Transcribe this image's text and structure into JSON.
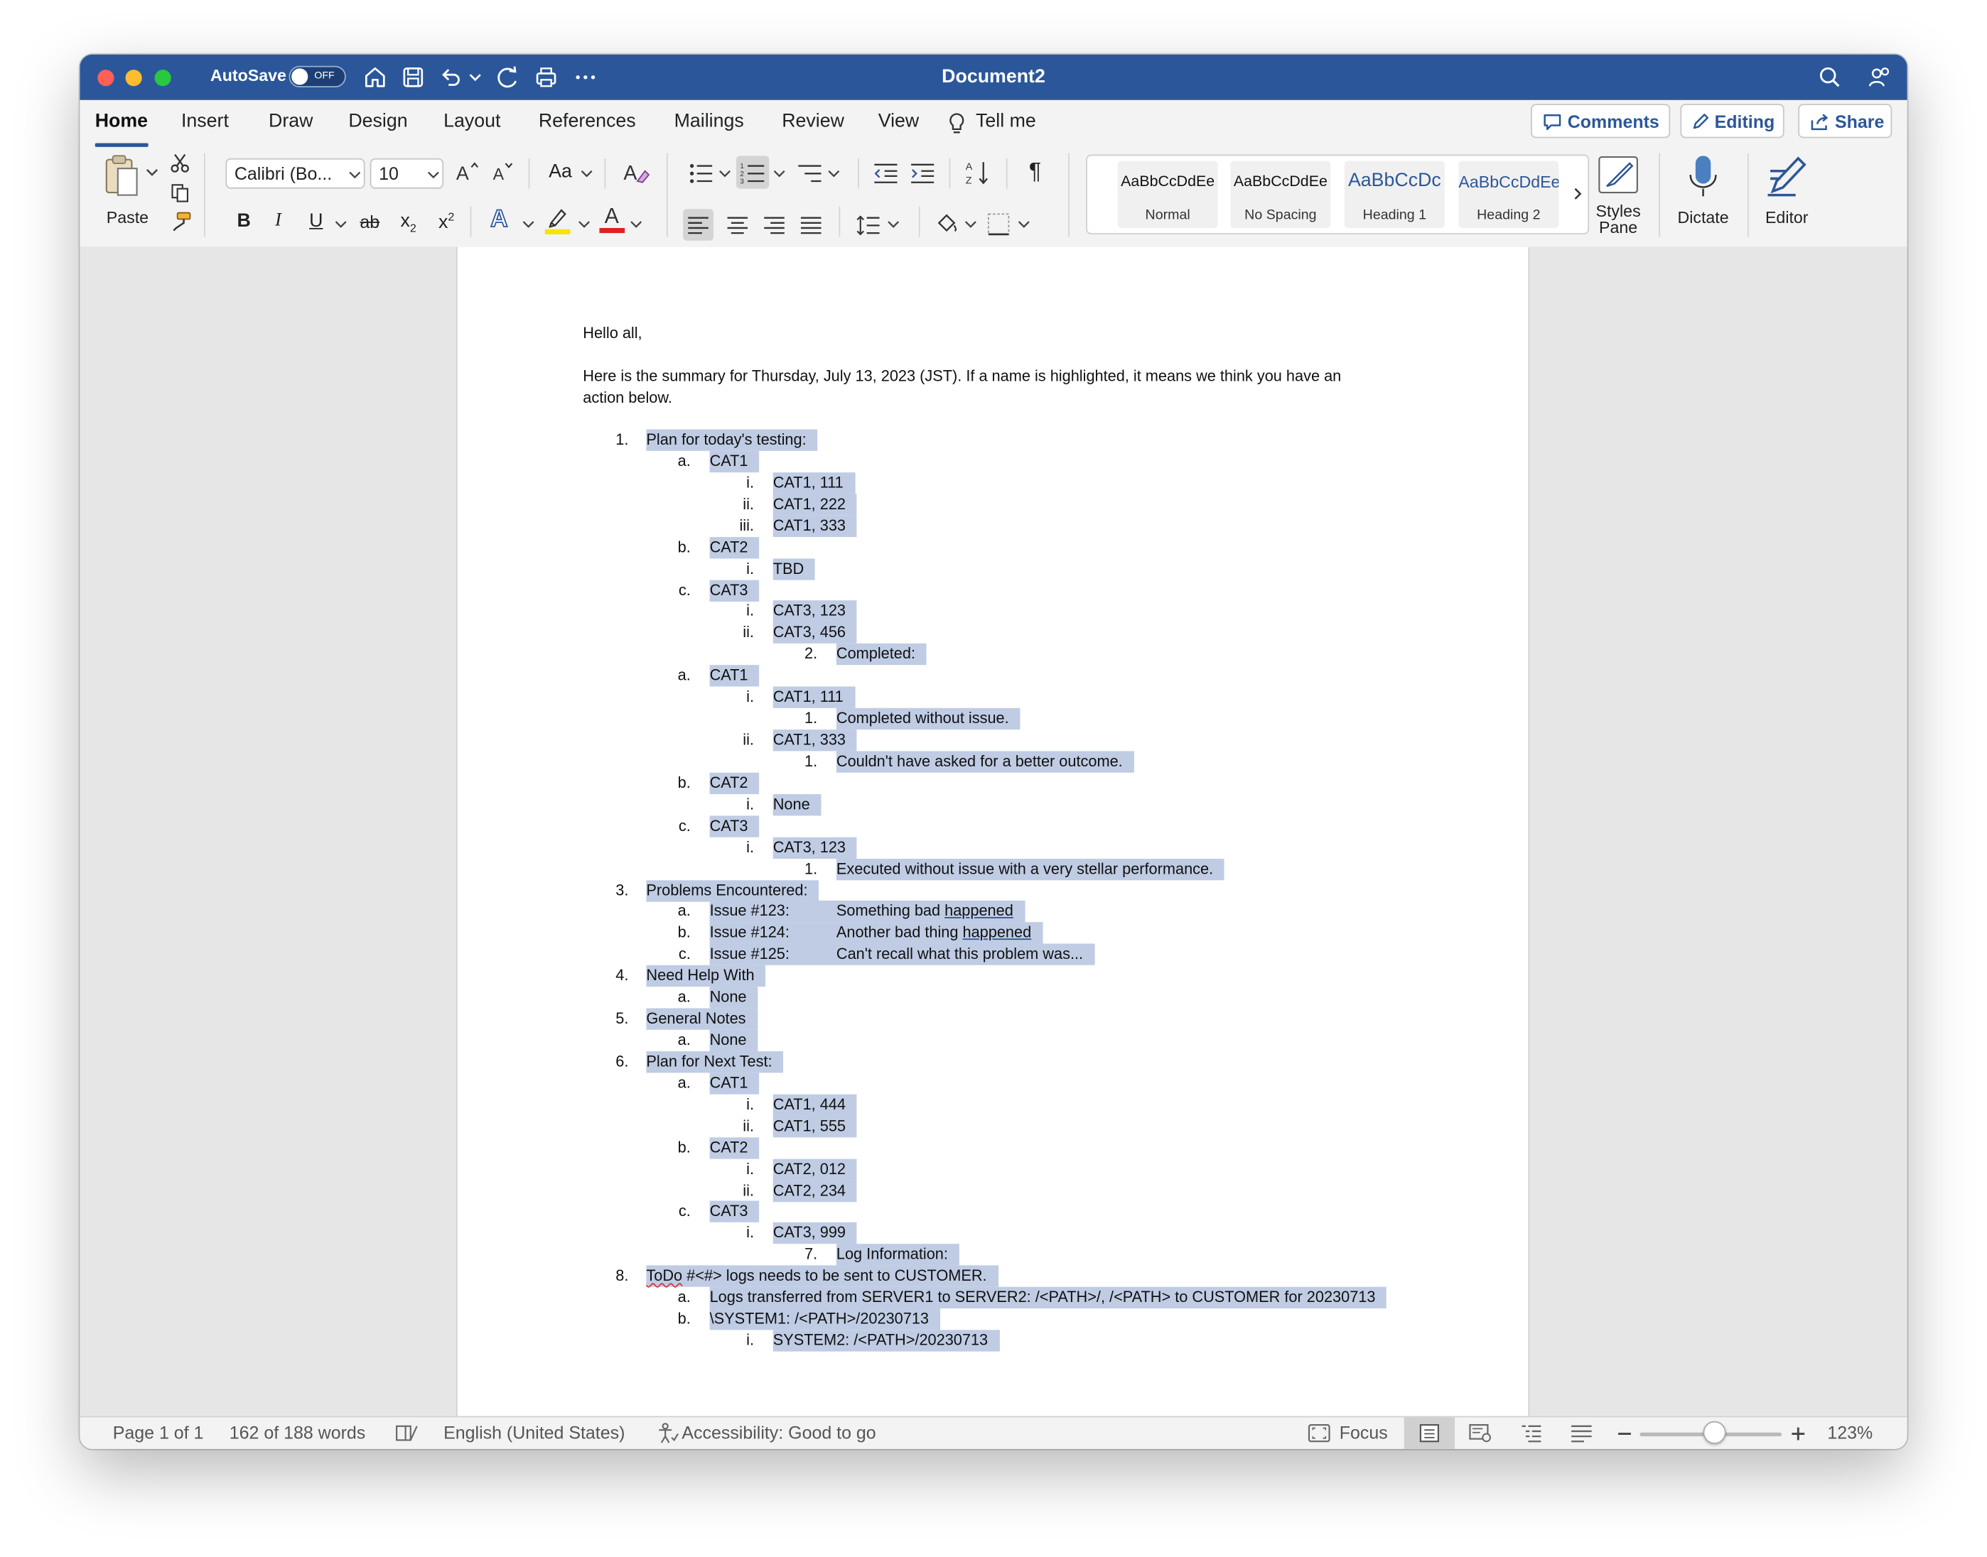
{
  "window": {
    "autosave_label": "AutoSave",
    "autosave_state": "OFF",
    "document_title": "Document2"
  },
  "tabs": [
    {
      "label": "Home",
      "active": true
    },
    {
      "label": "Insert"
    },
    {
      "label": "Draw"
    },
    {
      "label": "Design"
    },
    {
      "label": "Layout"
    },
    {
      "label": "References"
    },
    {
      "label": "Mailings"
    },
    {
      "label": "Review"
    },
    {
      "label": "View"
    },
    {
      "label": "Tell me"
    }
  ],
  "header_actions": {
    "comments": "Comments",
    "editing": "Editing",
    "share": "Share"
  },
  "ribbon": {
    "paste_label": "Paste",
    "font_name": "Calibri (Bo...",
    "font_size": "10",
    "change_case_label": "Aa",
    "styles": [
      {
        "preview": "AaBbCcDdEe",
        "name": "Normal"
      },
      {
        "preview": "AaBbCcDdEe",
        "name": "No Spacing"
      },
      {
        "preview": "AaBbCcDc",
        "name": "Heading 1"
      },
      {
        "preview": "AaBbCcDdEe",
        "name": "Heading 2"
      }
    ],
    "styles_pane_label_1": "Styles",
    "styles_pane_label_2": "Pane",
    "dictate_label": "Dictate",
    "editor_label": "Editor",
    "bold": "B",
    "italic": "I",
    "underline": "U",
    "strike": "ab",
    "subscript": "x",
    "superscript": "x",
    "text_effects": "A",
    "font_color": "A",
    "pilcrow": "¶",
    "colors": {
      "accent": "#2b579a",
      "highlight_yellow": "#f5e400",
      "font_red": "#e02020"
    }
  },
  "document": {
    "greeting": "Hello all,",
    "intro_line1": "Here is the summary for Thursday, July 13, 2023 (JST). If a name is highlighted, it means we think you have an",
    "intro_line2": "action below.",
    "list": [
      {
        "m": "1.",
        "t": "Plan for today's testing:"
      },
      {
        "m": "a.",
        "t": "CAT1"
      },
      {
        "m": "i.",
        "t": "CAT1, 111"
      },
      {
        "m": "ii.",
        "t": "CAT1, 222"
      },
      {
        "m": "iii.",
        "t": "CAT1, 333"
      },
      {
        "m": "b.",
        "t": "CAT2"
      },
      {
        "m": "i.",
        "t": "TBD"
      },
      {
        "m": "c.",
        "t": "CAT3"
      },
      {
        "m": "i.",
        "t": "CAT3, 123"
      },
      {
        "m": "ii.",
        "t": "CAT3, 456"
      },
      {
        "m": "2.",
        "t": "Completed:"
      },
      {
        "m": "a.",
        "t": "CAT1"
      },
      {
        "m": "i.",
        "t": "CAT1, 111"
      },
      {
        "m": "1.",
        "t": "Completed without issue."
      },
      {
        "m": "ii.",
        "t": "CAT1, 333"
      },
      {
        "m": "1.",
        "t": "Couldn't have asked for a better outcome."
      },
      {
        "m": "b.",
        "t": "CAT2"
      },
      {
        "m": "i.",
        "t": "None"
      },
      {
        "m": "c.",
        "t": "CAT3"
      },
      {
        "m": "i.",
        "t": "CAT3, 123"
      },
      {
        "m": "1.",
        "t": "Executed without issue with a very stellar performance."
      },
      {
        "m": "3.",
        "t": "Problems Encountered:"
      },
      {
        "m": "a.",
        "t": "Issue #123:",
        "t2": "Something bad ",
        "u": "happened"
      },
      {
        "m": "b.",
        "t": "Issue #124:",
        "t2": "Another bad thing ",
        "u": "happened"
      },
      {
        "m": "c.",
        "t": "Issue #125:",
        "t2": "Can't recall what this problem was..."
      },
      {
        "m": "4.",
        "t": "Need Help With"
      },
      {
        "m": "a.",
        "t": "None"
      },
      {
        "m": "5.",
        "t": "General Notes"
      },
      {
        "m": "a.",
        "t": "None"
      },
      {
        "m": "6.",
        "t": "Plan for Next Test:"
      },
      {
        "m": "a.",
        "t": "CAT1"
      },
      {
        "m": "i.",
        "t": "CAT1, 444"
      },
      {
        "m": "ii.",
        "t": "CAT1, 555"
      },
      {
        "m": "b.",
        "t": "CAT2"
      },
      {
        "m": "i.",
        "t": "CAT2, 012"
      },
      {
        "m": "ii.",
        "t": "CAT2, 234"
      },
      {
        "m": "c.",
        "t": "CAT3"
      },
      {
        "m": "i.",
        "t": "CAT3, 999"
      },
      {
        "m": "7.",
        "t": "Log Information:"
      },
      {
        "m": "8.",
        "s": "ToDo",
        "t": " #<#> logs needs to be sent to CUSTOMER."
      },
      {
        "m": "a.",
        "t": "Logs transferred from SERVER1 to SERVER2: /<PATH>/, /<PATH> to CUSTOMER for 20230713"
      },
      {
        "m": "b.",
        "t": "\\SYSTEM1: /<PATH>/20230713"
      },
      {
        "m": "i.",
        "t": "SYSTEM2: /<PATH>/20230713"
      }
    ]
  },
  "status": {
    "page": "Page 1 of 1",
    "words": "162 of 188 words",
    "language": "English (United States)",
    "accessibility": "Accessibility: Good to go",
    "focus": "Focus",
    "zoom": "123%",
    "zoom_percent": 123
  }
}
